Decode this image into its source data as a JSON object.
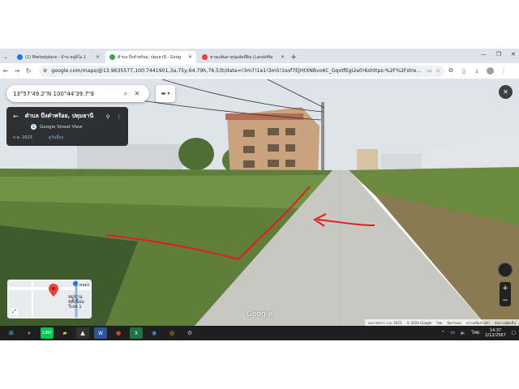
{
  "browser": {
    "tabs": [
      {
        "label": "(1) Marketplace - บ้าน คลูลิโอ 1",
        "icon_color": "#1877f2",
        "icon": "facebook-icon",
        "active": false
      },
      {
        "label": "ตำบล บึงคำพร้อย, ปทุมธานี - Goog",
        "icon_color": "#34a853",
        "icon": "google-maps-icon",
        "active": true
      },
      {
        "label": "ขายแพ้นดาทุนุ่มลัดที่ดิน (LandsMa",
        "icon_color": "#ea4335",
        "icon": "location-pin-icon",
        "active": false
      }
    ],
    "new_tab_symbol": "+",
    "url": "google.com/maps/@13.9635577,100.7441901,3a,75y,64.79h,76.53t/data=!3m7!1e1!3m5!1sof7EJHtXNBvo6C_GqxtfEgi2e0!6shttps:%2F%2Fstreetviewpixel..."
  },
  "streetview": {
    "search_query": "13°57'49.2\"N 100°44'39.7\"E",
    "place_name": "ตำบล บึงคำพร้อย, ปทุมธานี",
    "source": "Google Street View",
    "date": "ก.ค. 2023",
    "history_link": "ดูวันอื่นๆ",
    "minimap_label": "หมู่บ้าน\nชุติเนื้อม\nวิเลจ 1",
    "minimap_road": "คลอง",
    "watermark": "Google",
    "footer": [
      "ฉบภาพจาก: ก.ค. 2023",
      "© 2024 Google",
      "ไทย",
      "ข้อกำหนด",
      "ความเป็นส่วนตัว",
      "ส่งความคิดเห็น"
    ],
    "zoom_in": "+",
    "zoom_out": "−",
    "close": "✕"
  },
  "taskbar": {
    "language": "ไทย",
    "time": "14:37",
    "date": "2/12/2567"
  },
  "colors": {
    "annotation_red": "#e51c1c",
    "sky": "#dfe4ea",
    "grass": "#5f7e3a",
    "road": "#c8c8c2"
  }
}
